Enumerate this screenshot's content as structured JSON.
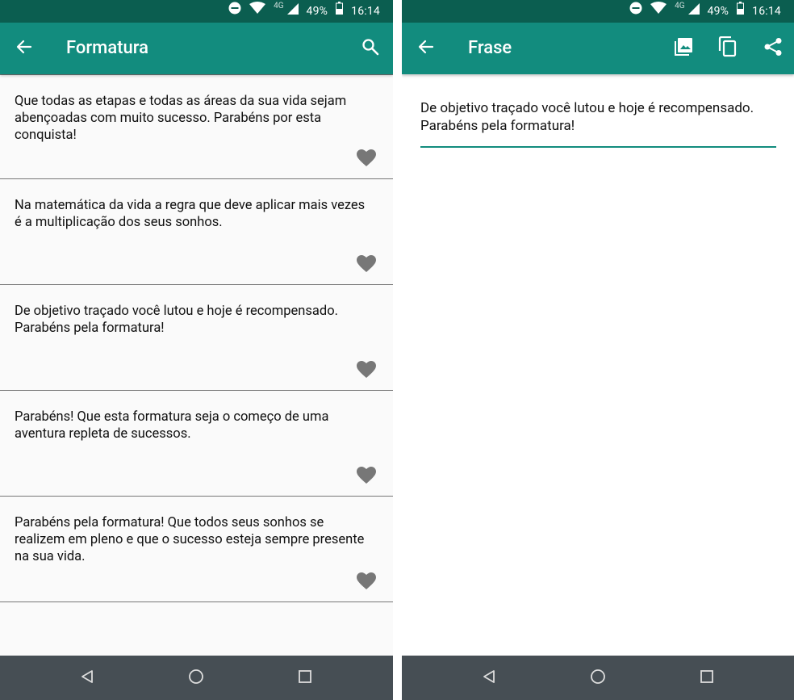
{
  "status_bar": {
    "network": "4G",
    "battery": "49%",
    "time": "16:14"
  },
  "left_screen": {
    "title": "Formatura",
    "phrases": [
      "Que todas as etapas e todas as áreas da sua vida sejam abençoadas com muito sucesso. Parabéns por esta conquista!",
      "Na matemática da vida a regra que deve aplicar mais vezes é a multiplicação dos seus sonhos.",
      "De objetivo traçado você lutou e hoje é recompensado. Parabéns pela formatura!",
      "Parabéns! Que esta formatura seja o começo de uma aventura repleta de sucessos.",
      "Parabéns pela formatura! Que todos seus sonhos se realizem em pleno e que o sucesso esteja sempre presente na sua vida."
    ]
  },
  "right_screen": {
    "title": "Frase",
    "phrase": "De objetivo traçado você lutou e hoje é recompensado. Parabéns pela formatura!"
  },
  "colors": {
    "status_bar": "#0b5e50",
    "app_bar": "#128c7e",
    "accent": "#128c7e",
    "nav_bar": "#464e54",
    "heart": "#777777"
  },
  "icons": [
    "dnd-icon",
    "wifi-icon",
    "signal-icon",
    "battery-icon",
    "back-arrow-icon",
    "search-icon",
    "image-icon",
    "copy-icon",
    "share-icon",
    "heart-icon",
    "nav-back-icon",
    "nav-home-icon",
    "nav-recents-icon"
  ]
}
